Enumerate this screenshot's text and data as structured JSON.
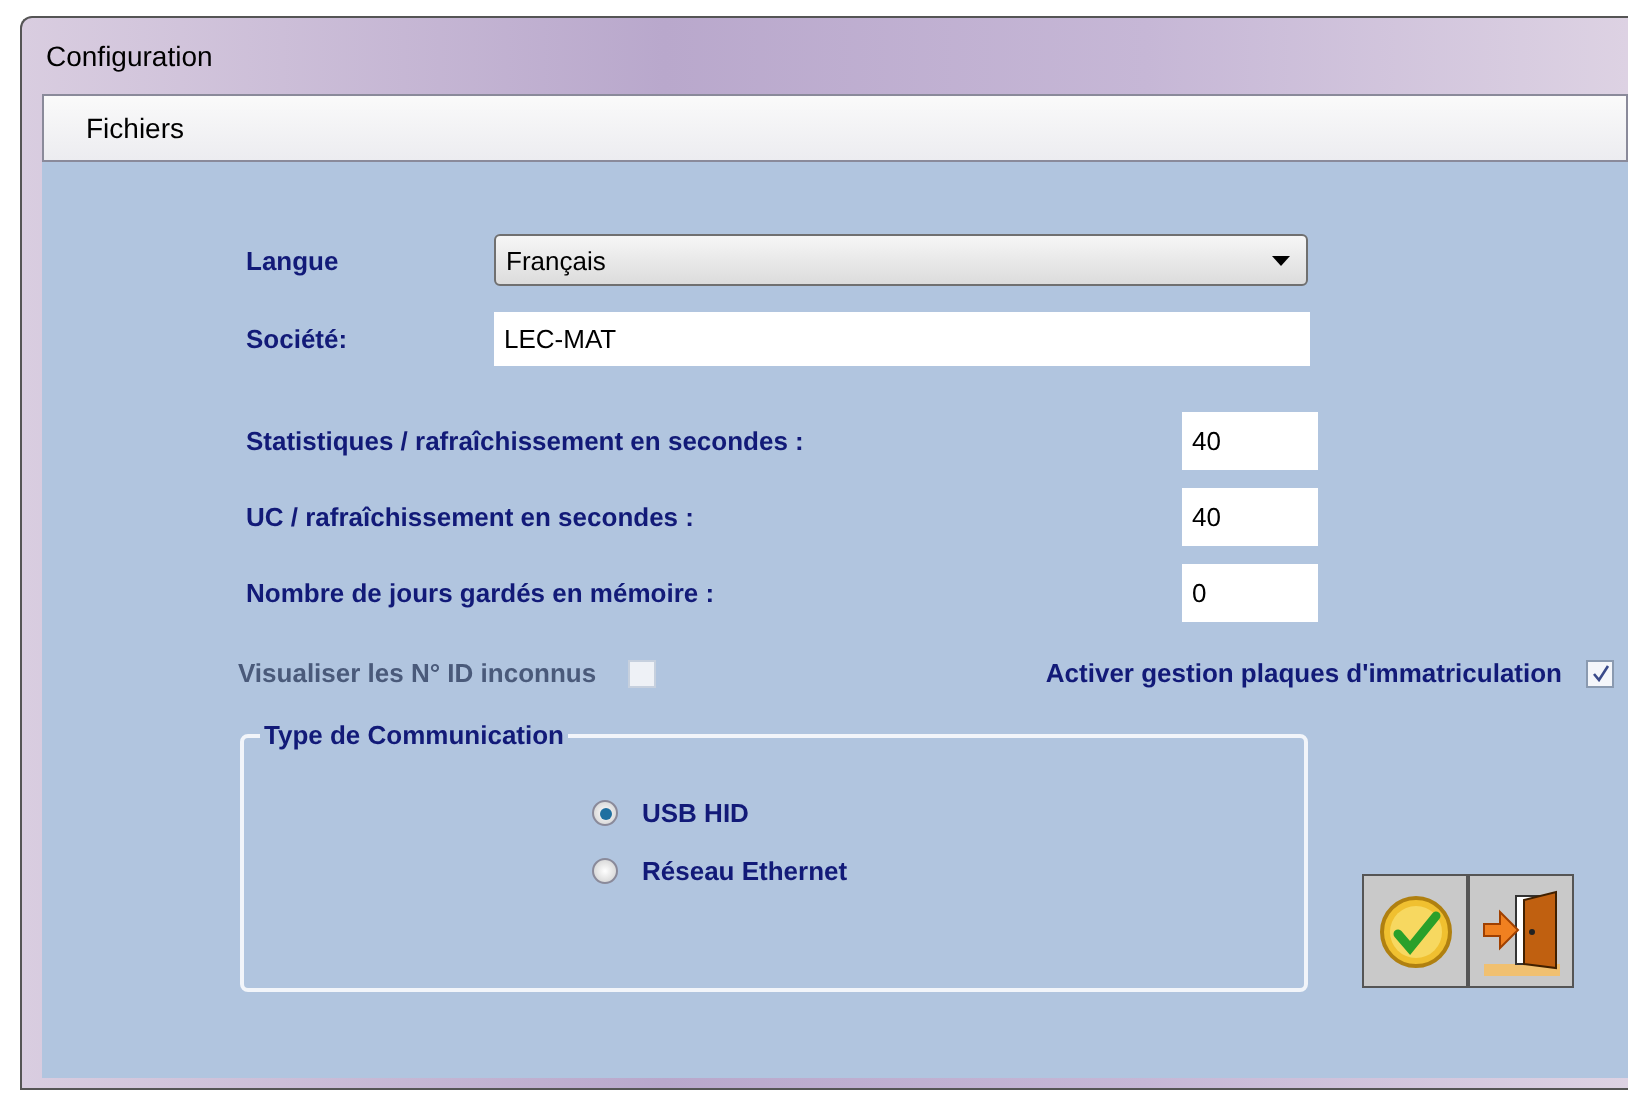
{
  "window": {
    "title": "Configuration"
  },
  "menu": [
    {
      "label": "Fichiers"
    }
  ],
  "langue": {
    "label": "Langue",
    "value": "Français"
  },
  "societe": {
    "label": "Société:",
    "value": "LEC-MAT"
  },
  "settings": [
    {
      "label": "Statistiques / rafraîchissement en secondes :",
      "value": "40"
    },
    {
      "label": "UC / rafraîchissement en secondes :",
      "value": "40"
    },
    {
      "label": "Nombre de jours gardés en mémoire :",
      "value": "0"
    }
  ],
  "checkboxes": [
    {
      "label": "Visualiser les N° ID inconnus",
      "checked": false,
      "disabled": true
    },
    {
      "label": "Activer gestion plaques d'immatriculation",
      "checked": true,
      "disabled": false
    }
  ],
  "communication": {
    "title": "Type de Communication",
    "options": [
      {
        "label": "USB HID",
        "selected": true
      },
      {
        "label": "Réseau Ethernet",
        "selected": false
      }
    ]
  },
  "buttons": [
    {
      "kind": "ok"
    },
    {
      "kind": "exit"
    }
  ]
}
